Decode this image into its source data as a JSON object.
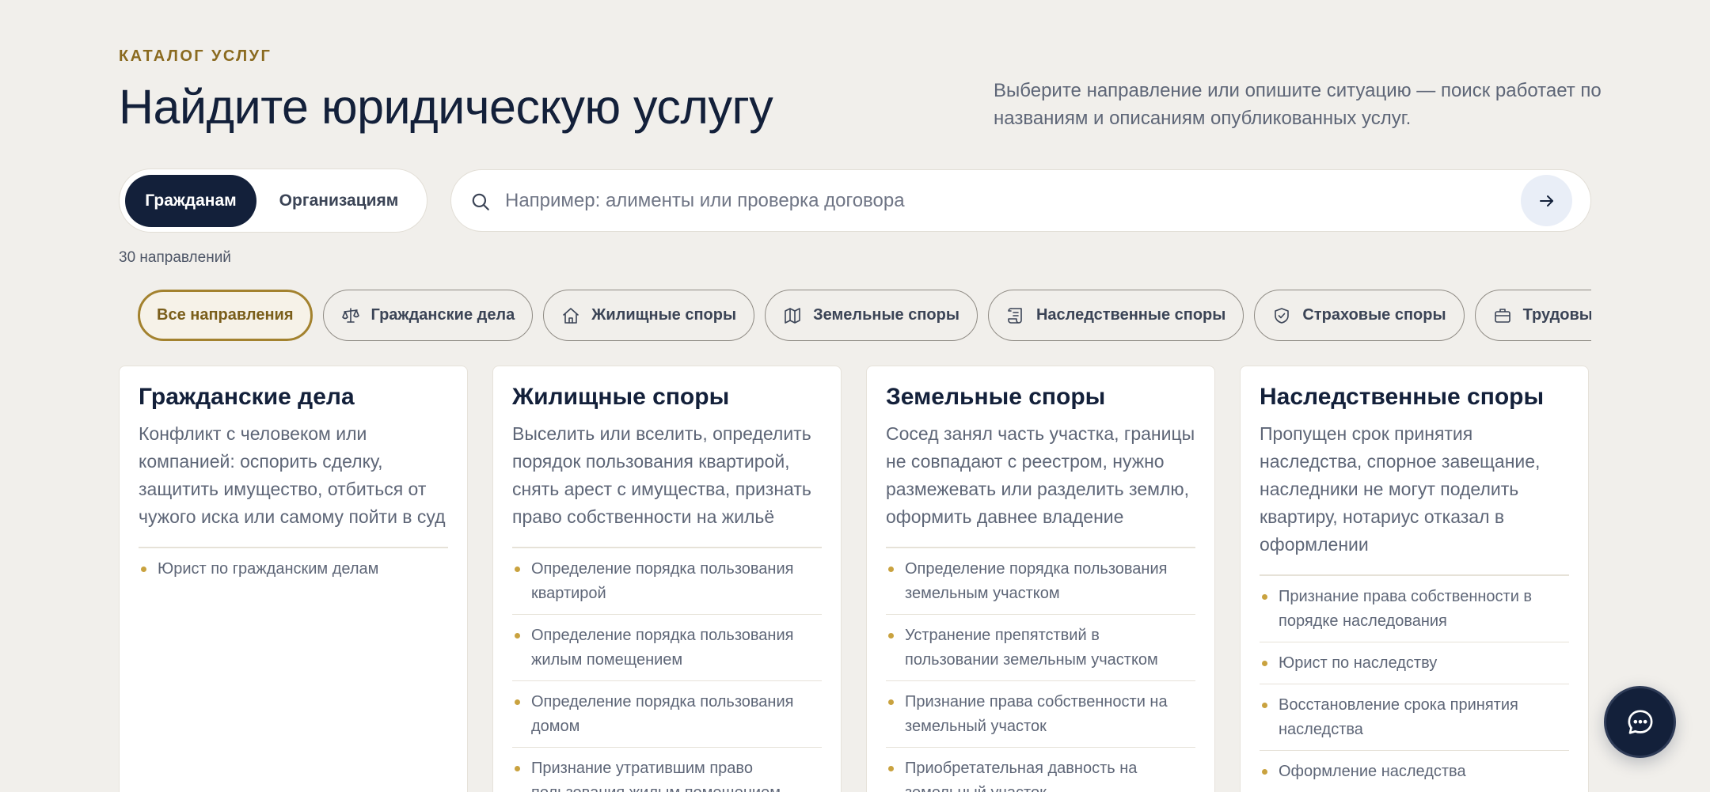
{
  "header": {
    "eyebrow": "КАТАЛОГ УСЛУГ",
    "title": "Найдите юридическую услугу",
    "lead": "Выберите направление или опишите ситуацию — поиск работает по названиям и описаниям опубликованных услуг."
  },
  "audience": {
    "options": [
      "Гражданам",
      "Организациям"
    ],
    "selected": "Гражданам"
  },
  "search": {
    "placeholder": "Например: алименты или проверка договора",
    "value": "",
    "icon": "search-icon",
    "submit_icon": "arrow-right-icon"
  },
  "count_label": "30 направлений",
  "chips": [
    {
      "label": "Все направления",
      "icon": "",
      "active": true
    },
    {
      "label": "Гражданские дела",
      "icon": "scales-icon",
      "active": false
    },
    {
      "label": "Жилищные споры",
      "icon": "house-icon",
      "active": false
    },
    {
      "label": "Земельные споры",
      "icon": "map-icon",
      "active": false
    },
    {
      "label": "Наследственные споры",
      "icon": "scroll-icon",
      "active": false
    },
    {
      "label": "Страховые споры",
      "icon": "shield-icon",
      "active": false
    },
    {
      "label": "Трудовые споры",
      "icon": "briefcase-icon",
      "active": false
    }
  ],
  "cards": [
    {
      "title": "Гражданские дела",
      "description": "Конфликт с человеком или компанией: оспорить сделку, защитить имущество, отбиться от чужого иска или самому пойти в суд",
      "services": [
        "Юрист по гражданским делам"
      ]
    },
    {
      "title": "Жилищные споры",
      "description": "Выселить или вселить, определить порядок пользования квартирой, снять арест с имущества, признать право собственности на жильё",
      "services": [
        "Определение порядка пользования квартирой",
        "Определение порядка пользования жилым помещением",
        "Определение порядка пользования домом",
        "Признание утратившим право пользования жилым помещением"
      ]
    },
    {
      "title": "Земельные споры",
      "description": "Сосед занял часть участка, границы не совпадают с реестром, нужно размежевать или разделить землю, оформить давнее владение",
      "services": [
        "Определение порядка пользования земельным участком",
        "Устранение препятствий в пользовании земельным участком",
        "Признание права собственности на земельный участок",
        "Приобретательная давность на земельный участок"
      ]
    },
    {
      "title": "Наследственные споры",
      "description": "Пропущен срок принятия наследства, спорное завещание, наследники не могут поделить квартиру, нотариус отказал в оформлении",
      "services": [
        "Признание права собственности в порядке наследования",
        "Юрист по наследству",
        "Восстановление срока принятия наследства",
        "Оформление наследства"
      ]
    }
  ],
  "chat": {
    "icon": "chat-icon"
  },
  "colors": {
    "navy": "#13203a",
    "gold": "#a3822e",
    "background": "#f1efeb"
  }
}
